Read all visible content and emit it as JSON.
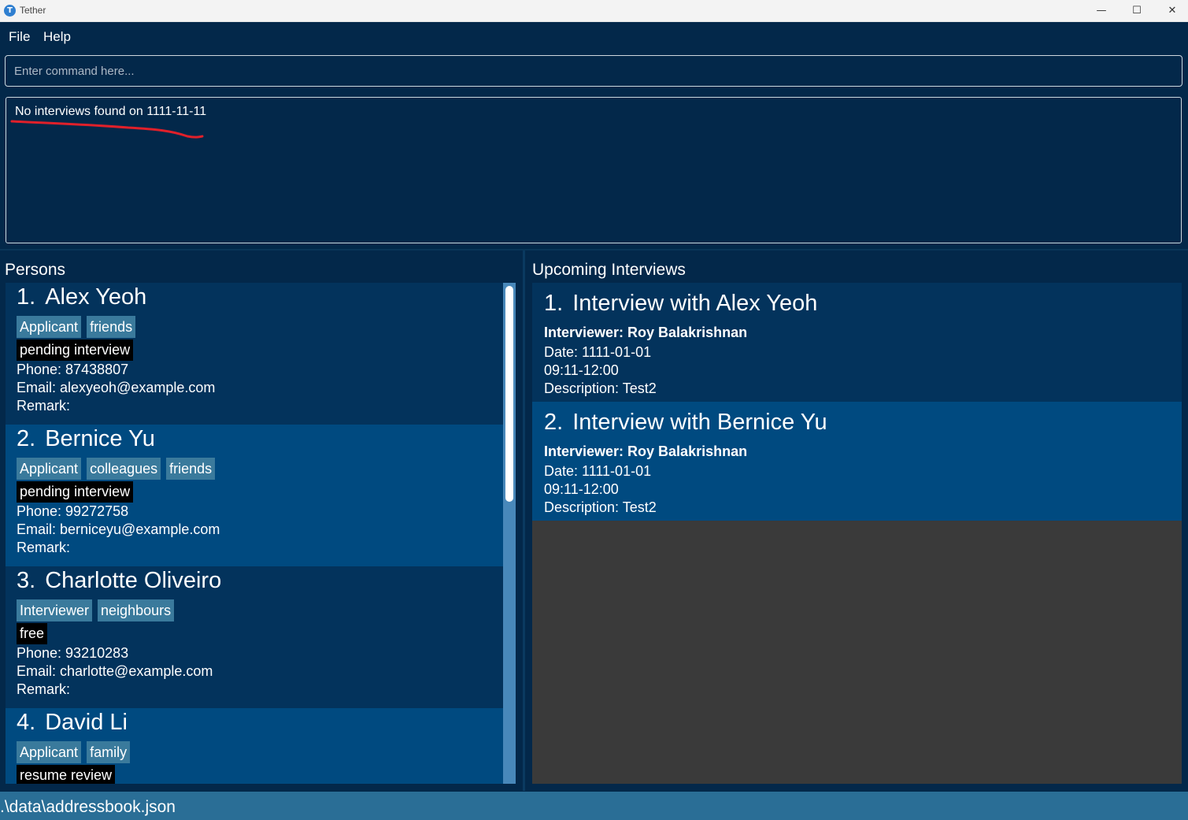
{
  "window": {
    "title": "Tether",
    "icon_letter": "T",
    "controls": {
      "minimize": "—",
      "maximize": "☐",
      "close": "✕"
    }
  },
  "menu": {
    "file": "File",
    "help": "Help"
  },
  "command": {
    "placeholder": "Enter command here...",
    "value": ""
  },
  "result": {
    "text": "No interviews found on 1111-11-11",
    "annotation_color": "#e0202a"
  },
  "persons_panel": {
    "title": "Persons",
    "persons": [
      {
        "index": "1.",
        "name": "Alex Yeoh",
        "tags": [
          "Applicant",
          "friends"
        ],
        "status": "pending interview",
        "phone": "Phone: 87438807",
        "email": "Email: alexyeoh@example.com",
        "remark": "Remark:"
      },
      {
        "index": "2.",
        "name": "Bernice Yu",
        "tags": [
          "Applicant",
          "colleagues",
          "friends"
        ],
        "status": "pending interview",
        "phone": "Phone: 99272758",
        "email": "Email: berniceyu@example.com",
        "remark": "Remark:"
      },
      {
        "index": "3.",
        "name": "Charlotte Oliveiro",
        "tags": [
          "Interviewer",
          "neighbours"
        ],
        "status": "free",
        "phone": "Phone: 93210283",
        "email": "Email: charlotte@example.com",
        "remark": "Remark:"
      },
      {
        "index": "4.",
        "name": "David Li",
        "tags": [
          "Applicant",
          "family"
        ],
        "status": "resume review",
        "phone": "",
        "email": "",
        "remark": ""
      }
    ]
  },
  "interviews_panel": {
    "title": "Upcoming Interviews",
    "interviews": [
      {
        "index": "1.",
        "title": "Interview with Alex Yeoh",
        "interviewer": "Interviewer: Roy Balakrishnan",
        "date": "Date: 1111-01-01",
        "time": "09:11-12:00",
        "description": "Description: Test2"
      },
      {
        "index": "2.",
        "title": "Interview with Bernice Yu",
        "interviewer": "Interviewer: Roy Balakrishnan",
        "date": "Date: 1111-01-01",
        "time": "09:11-12:00",
        "description": "Description: Test2"
      }
    ]
  },
  "statusbar": {
    "path": ".\\data\\addressbook.json"
  },
  "colors": {
    "background": "#03284a",
    "card_odd": "#03335c",
    "card_even": "#004a80",
    "tag": "#3a7a9c",
    "status_tag": "#000000",
    "statusbar": "#2a6e96"
  }
}
